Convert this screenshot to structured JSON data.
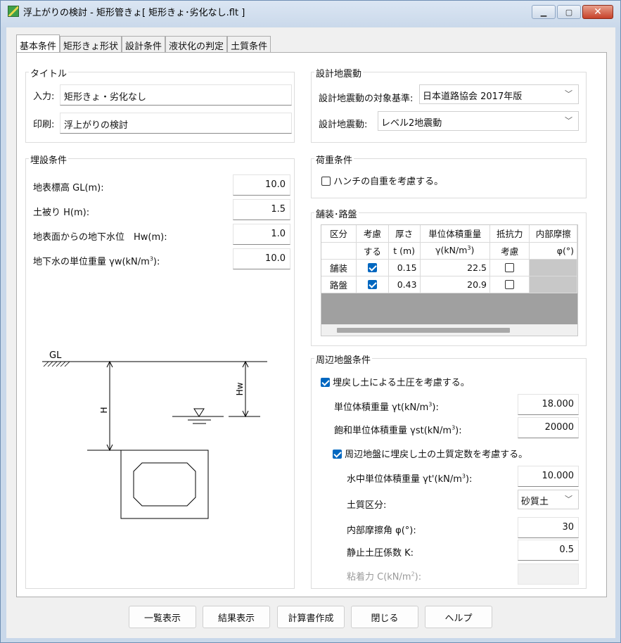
{
  "window": {
    "title": "浮上がりの検討 - 矩形管きょ[ 矩形きょ･劣化なし.flt ]",
    "minimize_icon": "minimize-icon",
    "maximize_icon": "maximize-icon",
    "close_icon": "close-icon"
  },
  "tabs": [
    "基本条件",
    "矩形きょ形状",
    "設計条件",
    "液状化の判定",
    "土質条件"
  ],
  "title_group": {
    "label": "タイトル",
    "input_label": "入力:",
    "input_value": "矩形きょ・劣化なし",
    "print_label": "印刷:",
    "print_value": "浮上がりの検討"
  },
  "seismic": {
    "label": "設計地震動",
    "standard_label": "設計地震動の対象基準:",
    "standard_value": "日本道路協会 2017年版",
    "motion_label": "設計地震動:",
    "motion_value": "レベル2地震動"
  },
  "burial": {
    "label": "埋設条件",
    "gl_label": "地表標高 GL(m):",
    "gl_value": "10.0",
    "cover_label": "土被り H(m):",
    "cover_value": "1.5",
    "water_label": "地表面からの地下水位　Hw(m):",
    "water_value": "1.0",
    "unitweight_label": "地下水の単位重量 γw(kN/m",
    "unitweight_sup": "3",
    "unitweight_tail": "):",
    "unitweight_value": "10.0"
  },
  "load": {
    "label": "荷重条件",
    "haunch_label": "ハンチの自重を考慮する。",
    "haunch_checked": false
  },
  "pavement": {
    "label": "舗装･路盤",
    "header1": [
      "区分",
      "考慮",
      "厚さ",
      "単位体積重量",
      "抵抗力",
      "内部摩擦"
    ],
    "header2": [
      "",
      "する",
      "t (m)",
      "γ(kN/m",
      "考慮",
      "φ(°)"
    ],
    "header2_sup": "3",
    "rows": [
      {
        "name": "舗装",
        "consider": true,
        "t": "0.15",
        "gamma": "22.5",
        "resist": false
      },
      {
        "name": "路盤",
        "consider": true,
        "t": "0.43",
        "gamma": "20.9",
        "resist": false
      }
    ]
  },
  "surround": {
    "label": "周辺地盤条件",
    "backfill_label": "埋戻し土による土圧を考慮する。",
    "backfill_checked": true,
    "gt_label": "単位体積重量 γt(kN/m",
    "gt_value": "18.000",
    "gst_label": "飽和単位体積重量 γst(kN/m",
    "gst_value": "20000",
    "sup": "3",
    "tail": "):",
    "soilconst_label": "周辺地盤に埋戻し土の土質定数を考慮する。",
    "soilconst_checked": true,
    "gt2_label": "水中単位体積重量 γt'(kN/m",
    "gt2_value": "10.000",
    "soiltype_label": "土質区分:",
    "soiltype_value": "砂質土",
    "phi_label": "内部摩擦角 φ(°):",
    "phi_value": "30",
    "k_label": "静止土圧係数 K:",
    "k_value": "0.5",
    "c_label": "粘着力 C(kN/m",
    "c_sup": "2",
    "c_value": ""
  },
  "diagram": {
    "gl": "GL",
    "h": "H",
    "hw": "Hw"
  },
  "buttons": [
    "一覧表示",
    "結果表示",
    "計算書作成",
    "閉じる",
    "ヘルプ"
  ]
}
